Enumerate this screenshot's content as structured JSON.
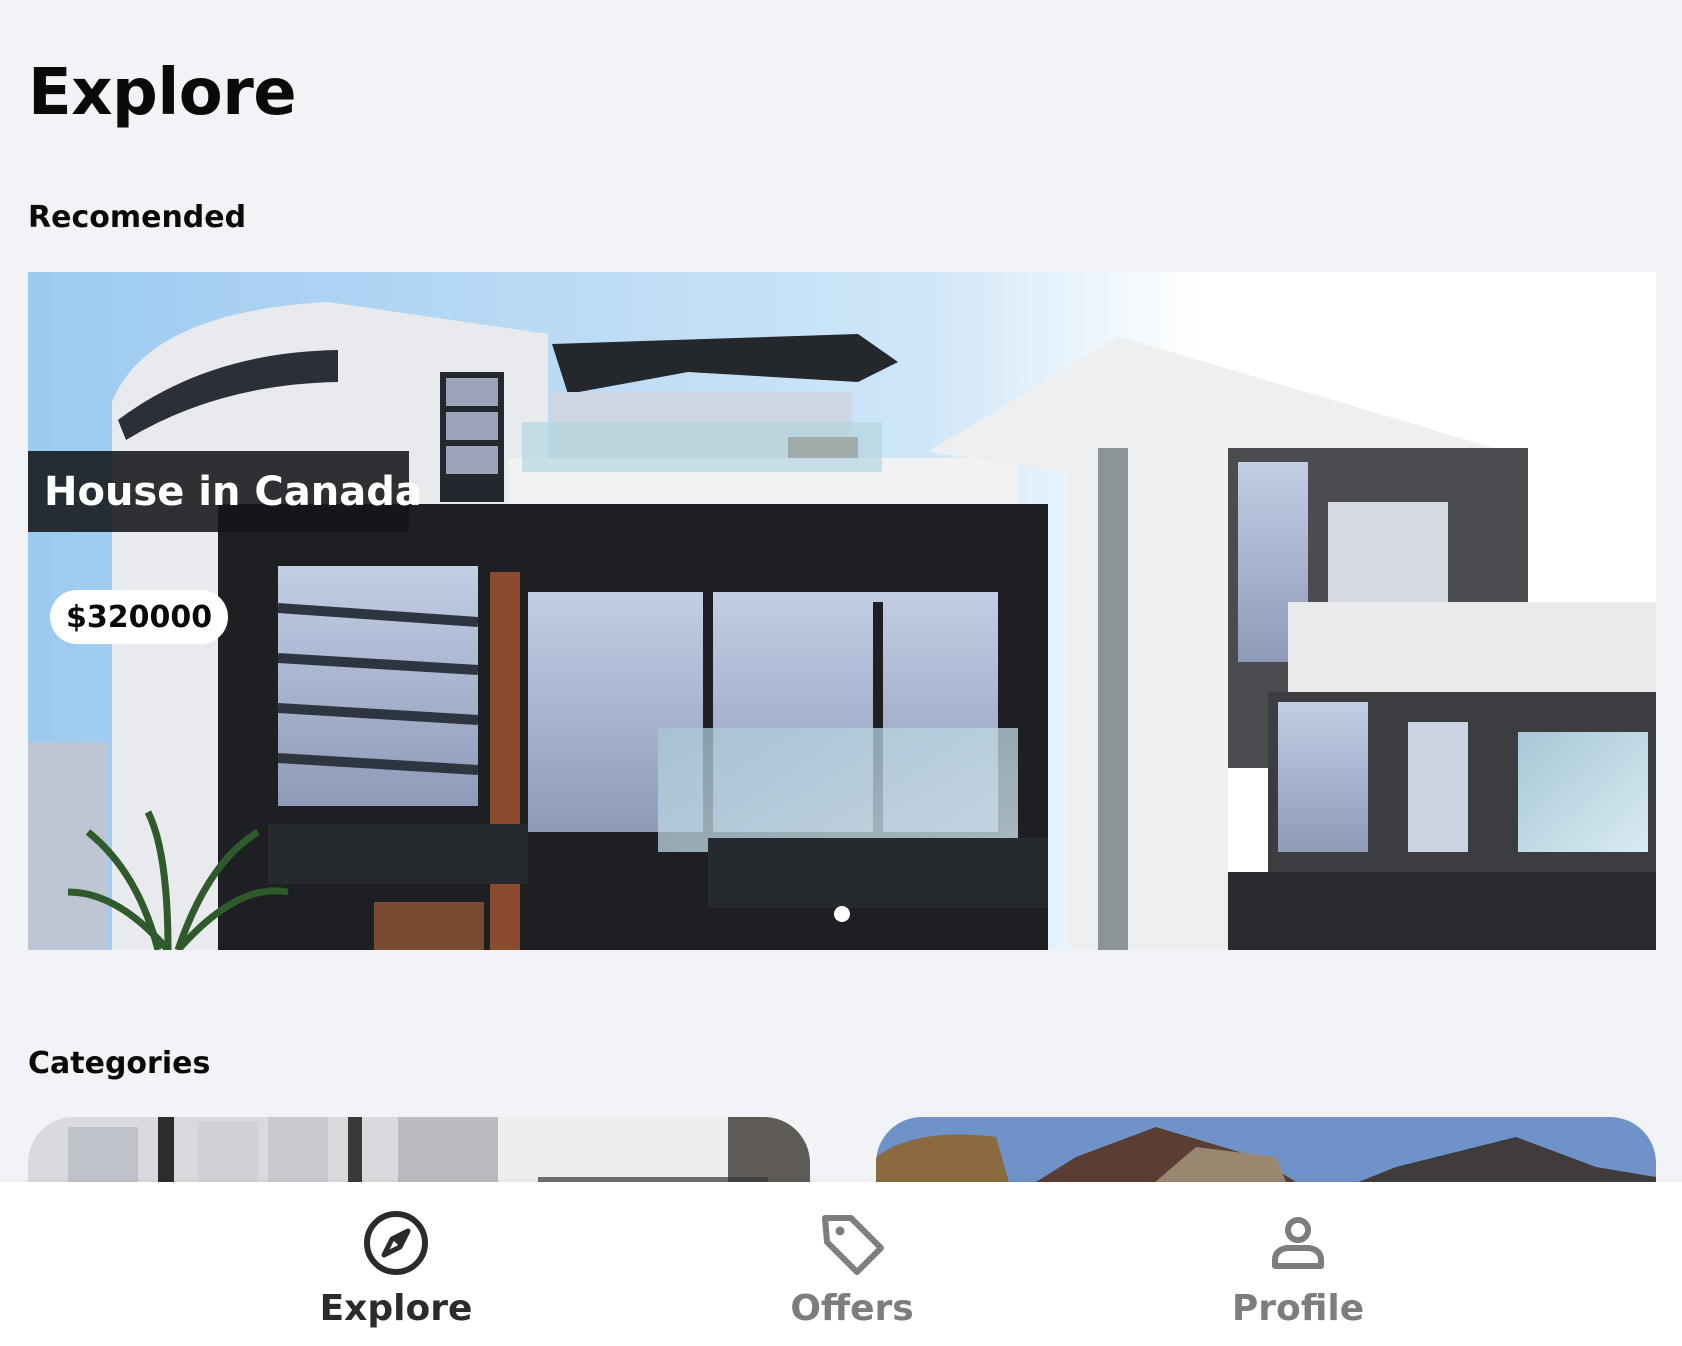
{
  "page": {
    "title": "Explore"
  },
  "recommended": {
    "heading": "Recomended",
    "card": {
      "title": "House in Canada",
      "price": "$320000",
      "image": "modern-house-photo"
    },
    "carousel": {
      "active_index": 1,
      "count": 1
    }
  },
  "categories": {
    "heading": "Categories",
    "cards": [
      {
        "image": "interior-window-photo"
      },
      {
        "image": "suburban-houses-photo"
      }
    ]
  },
  "tab_bar": {
    "tabs": [
      {
        "label": "Explore",
        "icon": "compass-icon",
        "active": true
      },
      {
        "label": "Offers",
        "icon": "tag-icon",
        "active": false
      },
      {
        "label": "Profile",
        "icon": "person-icon",
        "active": false
      }
    ],
    "active_color": "#2b2b2b",
    "inactive_color": "#7d7d7d"
  }
}
